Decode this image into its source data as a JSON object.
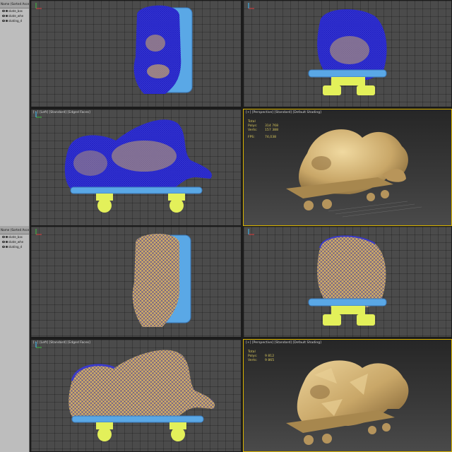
{
  "scenes": [
    {
      "explorer": {
        "header": "Name (Sorted Ascen",
        "items": [
          "skate_bas",
          "skate_whe",
          "skating_d"
        ]
      },
      "viewports": {
        "left": {
          "label": "[+] [Left] [Standard] [Edged Faces]"
        },
        "perspective": {
          "label": "[+] [Perspective] [Standard] [Default Shading]",
          "stats_total": "Total",
          "polys_label": "Polys:",
          "polys_value": "314 768",
          "verts_label": "Verts:",
          "verts_value": "157 388",
          "fps_label": "FPS:",
          "fps_value": "74,038"
        }
      }
    },
    {
      "explorer": {
        "header": "Name (Sorted Ascen",
        "items": [
          "skate_bas",
          "skate_whe",
          "skating_d"
        ]
      },
      "viewports": {
        "left": {
          "label": "[+] [Left] [Standard] [Edged Faces]"
        },
        "perspective": {
          "label": "[+] [Perspective] [Standard] [Default Shading]",
          "stats_total": "Total",
          "polys_label": "Polys:",
          "polys_value": "9 812",
          "verts_label": "Verts:",
          "verts_value": "9 865"
        }
      }
    }
  ],
  "colors": {
    "wire_dense": "#2b2bd8",
    "wire_low": "#3a3ac8",
    "board": "#5aa8e6",
    "wheels": "#e3f05a",
    "clay": "#c9a768",
    "active_border": "#d9b400"
  }
}
